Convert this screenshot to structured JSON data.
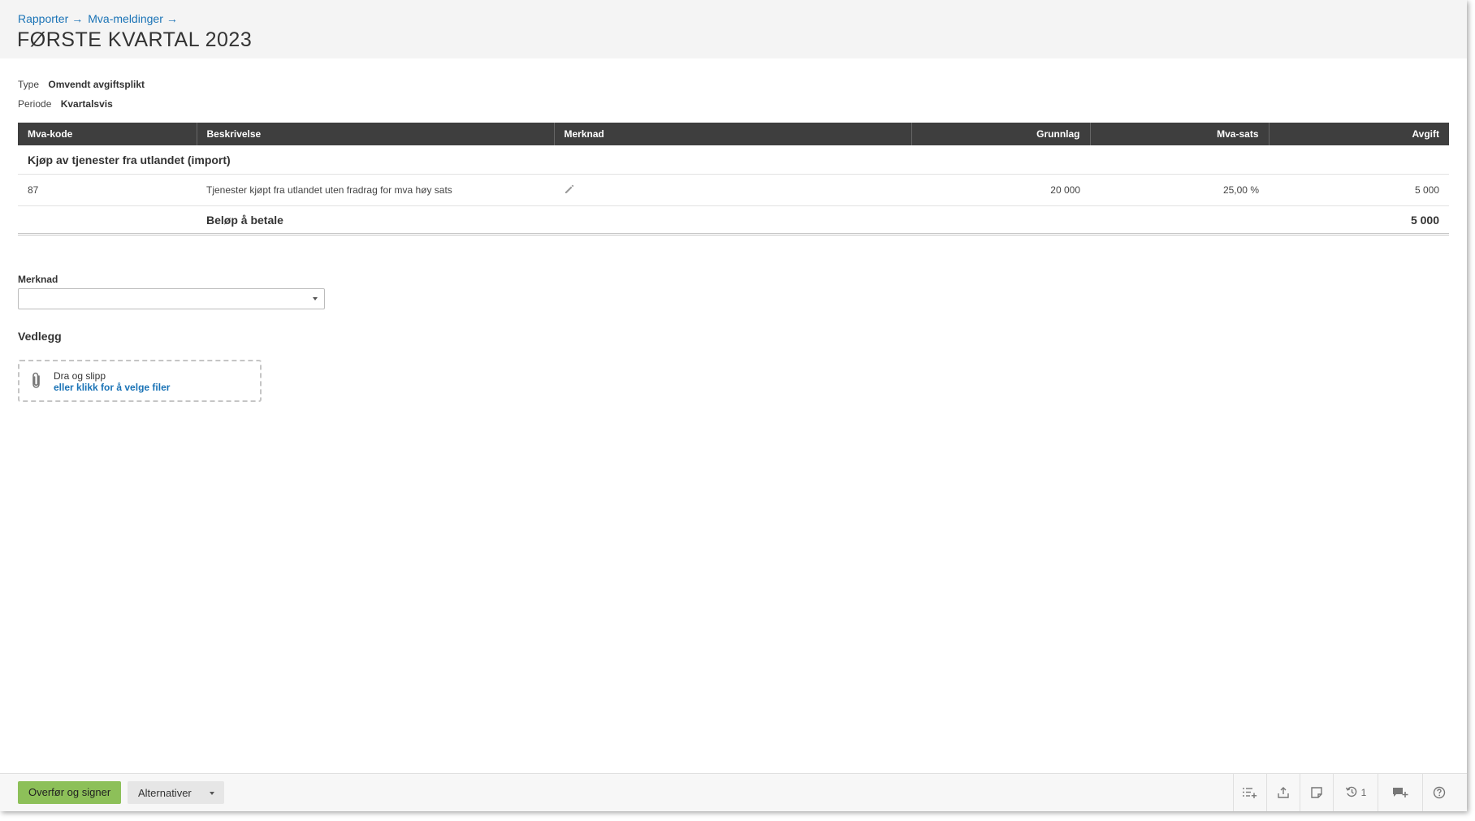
{
  "breadcrumb": {
    "items": [
      "Rapporter",
      "Mva-meldinger"
    ],
    "separator": "→"
  },
  "page": {
    "title": "FØRSTE KVARTAL 2023"
  },
  "meta": {
    "type_label": "Type",
    "type_value": "Omvendt avgiftsplikt",
    "period_label": "Periode",
    "period_value": "Kvartalsvis"
  },
  "table": {
    "headers": {
      "code": "Mva-kode",
      "description": "Beskrivelse",
      "note": "Merknad",
      "base": "Grunnlag",
      "rate": "Mva-sats",
      "fee": "Avgift"
    },
    "group_title": "Kjøp av tjenester fra utlandet (import)",
    "rows": [
      {
        "code": "87",
        "description": "Tjenester kjøpt fra utlandet uten fradrag for mva høy sats",
        "base": "20 000",
        "rate": "25,00 %",
        "fee": "5 000"
      }
    ],
    "total_label": "Beløp å betale",
    "total_value": "5 000"
  },
  "remark": {
    "label": "Merknad",
    "value": ""
  },
  "attachments": {
    "title": "Vedlegg",
    "drop_text": "Dra og slipp",
    "click_text": "eller klikk for å velge filer"
  },
  "footer": {
    "primary_label": "Overfør og signer",
    "alt_label": "Alternativer",
    "history_count": "1"
  },
  "colors": {
    "accent": "#1a73b6",
    "primary_button": "#8dc059",
    "table_header": "#3e3e3e"
  },
  "icons": {
    "note_edit": "pencil-icon",
    "attachment": "paperclip-icon",
    "toolbar": [
      "add-task-icon",
      "export-icon",
      "note-icon",
      "history-icon",
      "comment-add-icon",
      "help-icon"
    ]
  }
}
